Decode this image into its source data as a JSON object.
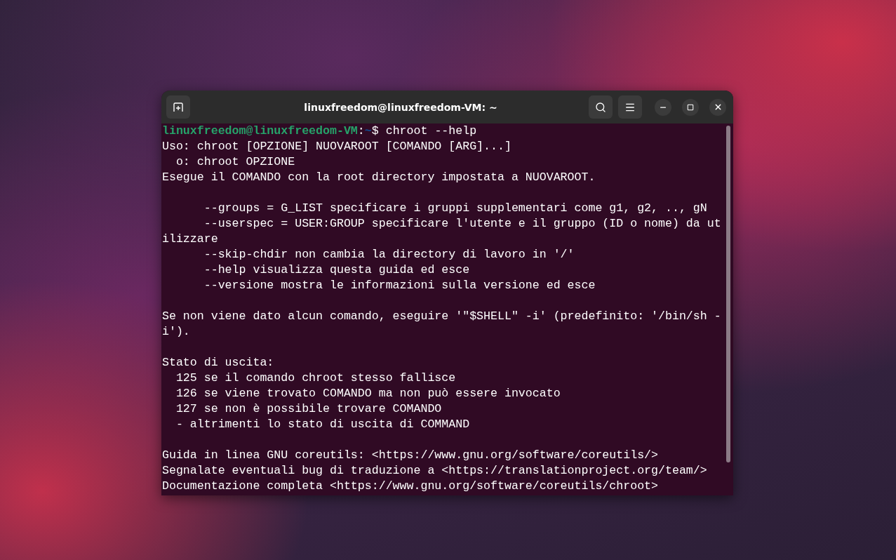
{
  "window": {
    "title": "linuxfreedom@linuxfreedom-VM: ~"
  },
  "prompt": [
    {
      "kind": "host",
      "text": "linuxfreedom@linuxfreedom-VM"
    },
    {
      "kind": "plain",
      "text": ":"
    },
    {
      "kind": "path",
      "text": "~"
    },
    {
      "kind": "plain",
      "text": "$ chroot --help"
    }
  ],
  "output_blocks": [
    [
      "Uso: chroot [OPZIONE] NUOVAROOT [COMANDO [ARG]...]",
      "  o: chroot OPZIONE",
      "Esegue il COMANDO con la root directory impostata a NUOVAROOT."
    ],
    [
      "      --groups = G_LIST specificare i gruppi supplementari come g1, g2, .., gN",
      "      --userspec = USER:GROUP specificare l'utente e il gruppo (ID o nome) da ut",
      "ilizzare",
      "      --skip-chdir non cambia la directory di lavoro in '/'",
      "      --help visualizza questa guida ed esce",
      "      --versione mostra le informazioni sulla versione ed esce"
    ],
    [
      "Se non viene dato alcun comando, eseguire '\"$SHELL\" -i' (predefinito: '/bin/sh -",
      "i')."
    ],
    [
      "Stato di uscita:",
      "  125 se il comando chroot stesso fallisce",
      "  126 se viene trovato COMANDO ma non può essere invocato",
      "  127 se non è possibile trovare COMANDO",
      "  - altrimenti lo stato di uscita di COMMAND"
    ],
    [
      "Guida in linea GNU coreutils: <https://www.gnu.org/software/coreutils/>",
      "Segnalate eventuali bug di traduzione a <https://translationproject.org/team/>",
      "Documentazione completa <https://www.gnu.org/software/coreutils/chroot>"
    ]
  ]
}
